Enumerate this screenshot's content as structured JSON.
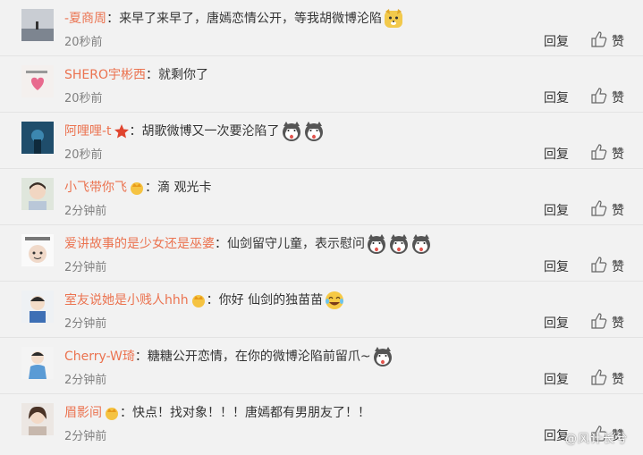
{
  "reply_label": "回复",
  "like_label": "赞",
  "colon": "：",
  "comments": [
    {
      "user": "-夏商周",
      "text": "来早了来早了，唐嫣恋情公开，等我胡微博沦陷",
      "time": "20秒前",
      "emoji": [
        "doge-icon"
      ],
      "badge": ""
    },
    {
      "user": "SHERO宇彬西",
      "text": "就剩你了",
      "time": "20秒前",
      "emoji": [],
      "badge": ""
    },
    {
      "user": "阿哩哩-t",
      "text": "胡歌微博又一次要沦陷了",
      "time": "20秒前",
      "emoji": [
        "husky-icon",
        "husky-icon"
      ],
      "badge": "star-badge-icon"
    },
    {
      "user": "小飞带你飞",
      "text": "滴 观光卡",
      "time": "2分钟前",
      "emoji": [],
      "badge": "crown-badge-icon"
    },
    {
      "user": "爱讲故事的是少女还是巫婆",
      "text": "仙剑留守儿童，表示慰问",
      "time": "2分钟前",
      "emoji": [
        "husky-icon",
        "husky-icon",
        "husky-icon"
      ],
      "badge": ""
    },
    {
      "user": "室友说她是小贱人hhh",
      "text": "你好 仙剑的独苗苗",
      "time": "2分钟前",
      "emoji": [
        "laugh-cry-icon"
      ],
      "badge": "crown-badge-icon"
    },
    {
      "user": "Cherry-W琦",
      "text": "糖糖公开恋情，在你的微博沦陷前留爪~",
      "time": "2分钟前",
      "emoji": [
        "husky-icon"
      ],
      "badge": ""
    },
    {
      "user": "眉影间",
      "text": "快点！找对象！！！唐嫣都有男朋友了！！",
      "time": "2分钟前",
      "emoji": [],
      "badge": "crown-badge-icon"
    }
  ],
  "colors": {
    "username": "#eb7350",
    "text": "#333333",
    "time": "#808080",
    "background": "#f2f2f2"
  },
  "watermark": "@风计长兮"
}
